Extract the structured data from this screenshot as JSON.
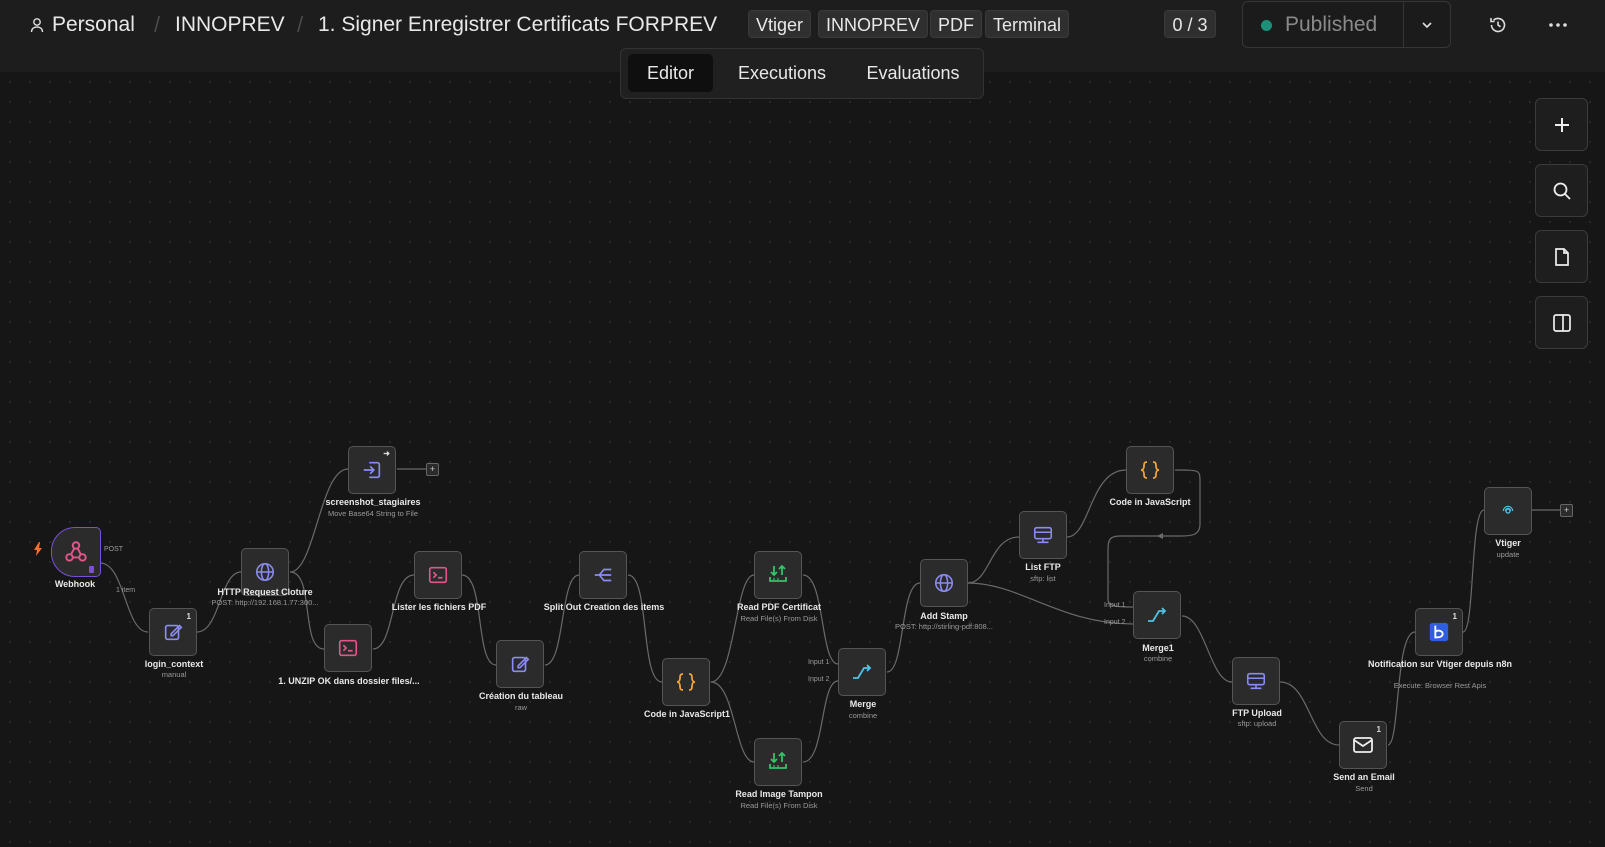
{
  "header": {
    "personal": "Personal",
    "project": "INNOPREV",
    "workflow_title": "1. Signer Enregistrer Certificats FORPREV",
    "tags": [
      "Vtiger",
      "INNOPREV",
      "PDF",
      "Terminal"
    ],
    "counter": "0 / 3",
    "publish_status": "Published"
  },
  "tabs": [
    "Editor",
    "Executions",
    "Evaluations"
  ],
  "active_tab": "Editor",
  "colors": {
    "accent_purple": "#7b4fd8",
    "status_green": "#1e8f7a",
    "icon_blue": "#8b8bf5",
    "icon_orange": "#f0a23a",
    "icon_green": "#35c46a",
    "icon_pink": "#e0558a",
    "icon_cyan": "#4fc3e8"
  },
  "nodes": {
    "webhook": {
      "title": "Webhook",
      "sub": "",
      "icon": "webhook-icon",
      "out_label": "POST"
    },
    "login_context": {
      "title": "login_context",
      "sub": "manual",
      "icon": "edit-icon",
      "badge": "1"
    },
    "http_cloture": {
      "title": "HTTP Request Cloture",
      "sub": "POST: http://192.168.1.77:300...",
      "icon": "globe-icon"
    },
    "screenshot": {
      "title": "screenshot_stagiaires",
      "sub": "Move Base64 String to File",
      "icon": "file-convert-icon"
    },
    "unzip": {
      "title": "1. UNZIP OK dans dossier files/...",
      "sub": "",
      "icon": "terminal-icon"
    },
    "lister": {
      "title": "Lister les fichiers PDF",
      "sub": "",
      "icon": "terminal-icon"
    },
    "creation_tableau": {
      "title": "Création du tableau",
      "sub": "raw",
      "icon": "edit-icon"
    },
    "split_out": {
      "title": "Split Out Creation des items",
      "sub": "",
      "icon": "split-icon"
    },
    "code_js1": {
      "title": "Code in JavaScript1",
      "sub": "",
      "icon": "code-braces-icon"
    },
    "read_pdf": {
      "title": "Read PDF Certificat",
      "sub": "Read File(s) From Disk",
      "icon": "file-read-icon"
    },
    "read_image": {
      "title": "Read Image Tampon",
      "sub": "Read File(s) From Disk",
      "icon": "file-read-icon"
    },
    "merge": {
      "title": "Merge",
      "sub": "combine",
      "icon": "merge-icon"
    },
    "add_stamp": {
      "title": "Add Stamp",
      "sub": "POST: http://stirling-pdf:808...",
      "icon": "globe-icon"
    },
    "list_ftp": {
      "title": "List FTP",
      "sub": "sftp: list",
      "icon": "ftp-icon"
    },
    "code_js": {
      "title": "Code in JavaScript",
      "sub": "",
      "icon": "code-braces-icon"
    },
    "merge1": {
      "title": "Merge1",
      "sub": "combine",
      "icon": "merge-icon"
    },
    "ftp_upload": {
      "title": "FTP Upload",
      "sub": "sftp: upload",
      "icon": "ftp-icon"
    },
    "send_email": {
      "title": "Send an Email",
      "sub": "Send",
      "icon": "mail-icon",
      "badge": "1"
    },
    "notif_vtiger": {
      "title": "Notification sur Vtiger depuis n8n",
      "sub": "Execute: Browser Rest Apis",
      "icon": "browserless-icon",
      "badge": "1"
    },
    "vtiger": {
      "title": "Vtiger",
      "sub": "update",
      "icon": "vtiger-icon"
    }
  },
  "edge_labels": {
    "one_item": "1 item",
    "input1": "Input 1",
    "input2": "Input 2"
  }
}
